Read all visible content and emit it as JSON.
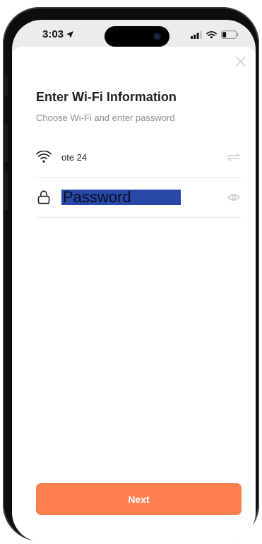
{
  "status_bar": {
    "time": "3:03"
  },
  "sheet": {
    "title": "Enter Wi-Fi Information",
    "subtitle": "Choose Wi-Fi and enter password"
  },
  "wifi_row": {
    "network_name": "ote 24",
    "icon": "wifi-icon",
    "action_icon": "switch-network-icon"
  },
  "password_row": {
    "icon": "lock-icon",
    "placeholder": "Password",
    "value": "",
    "action_icon": "eye-icon"
  },
  "actions": {
    "next_label": "Next"
  },
  "colors": {
    "accent": "#ff7f50",
    "selection_highlight": "#2848a8",
    "subtitle": "#8e8e8e"
  }
}
